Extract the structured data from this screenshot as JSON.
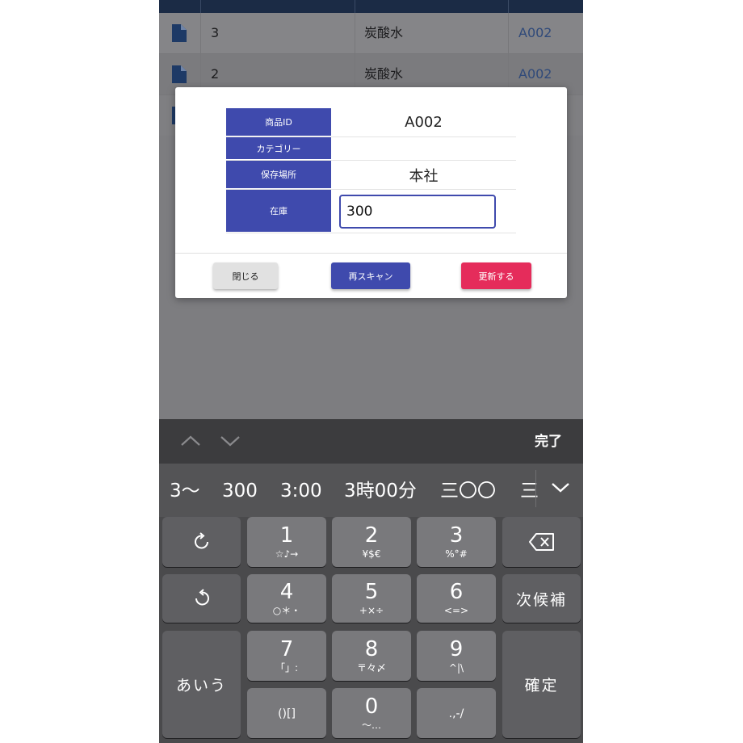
{
  "background_table": {
    "rows": [
      {
        "no": "3",
        "name": "炭酸水",
        "id": "A002"
      },
      {
        "no": "2",
        "name": "炭酸水",
        "id": "A002"
      }
    ]
  },
  "dialog": {
    "fields": [
      {
        "label": "商品ID",
        "value": "A002"
      },
      {
        "label": "カテゴリー",
        "value": ""
      },
      {
        "label": "保存場所",
        "value": "本社"
      },
      {
        "label": "在庫",
        "value": "300"
      }
    ],
    "buttons": {
      "close": "閉じる",
      "rescan": "再スキャン",
      "update": "更新する"
    },
    "colors": {
      "primary": "#3f4aad",
      "accent": "#e52c5b"
    }
  },
  "keyboard": {
    "done_label": "完了",
    "candidates": [
      "3〜",
      "300",
      "3:00",
      "3時00分",
      "三〇〇",
      "三"
    ],
    "keys": {
      "k1": {
        "main": "1",
        "sub": "☆♪→"
      },
      "k2": {
        "main": "2",
        "sub": "¥$€"
      },
      "k3": {
        "main": "3",
        "sub": "%°#"
      },
      "k4": {
        "main": "4",
        "sub": "○＊・"
      },
      "k5": {
        "main": "5",
        "sub": "+×÷"
      },
      "k6": {
        "main": "6",
        "sub": "<=>"
      },
      "k7": {
        "main": "7",
        "sub": "「」:"
      },
      "k8": {
        "main": "8",
        "sub": "〒々〆"
      },
      "k9": {
        "main": "9",
        "sub": "^|\\"
      },
      "k0": {
        "main": "0",
        "sub": "〜…"
      },
      "brackets": "()[]",
      "punct": ".,-/",
      "next_candidate": "次候補",
      "kana": "あいう",
      "confirm": "確定"
    }
  }
}
